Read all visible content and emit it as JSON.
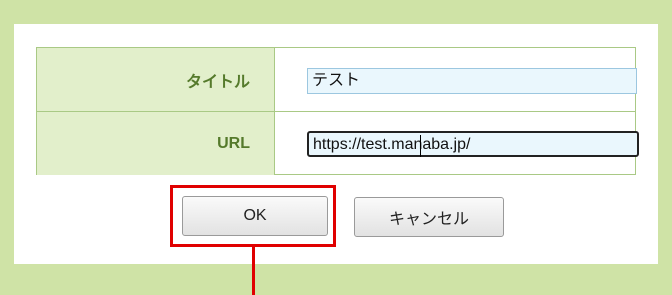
{
  "form": {
    "title_label": "タイトル",
    "title_value": "テスト",
    "url_label": "URL",
    "url_value": "https://test.manaba.jp/"
  },
  "buttons": {
    "ok_label": "OK",
    "cancel_label": "キャンセル"
  },
  "colors": {
    "highlight": "#e00000",
    "label_text": "#557a2b",
    "frame_bg": "#cfe3a6"
  }
}
